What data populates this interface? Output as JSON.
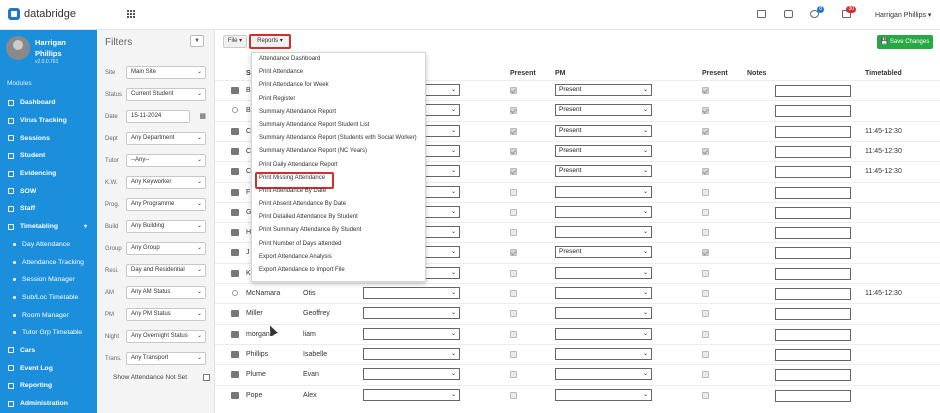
{
  "app": {
    "name": "databridge",
    "user": "Harrigan Phillips",
    "badge1": "8",
    "badge2": "30"
  },
  "profile": {
    "name_line1": "Harrigan",
    "name_line2": "Phillips",
    "version": "v2.0.0.761"
  },
  "sidebar": {
    "section": "Modules",
    "items": [
      {
        "label": "Dashboard",
        "sub": false
      },
      {
        "label": "Virus Tracking",
        "sub": false
      },
      {
        "label": "Sessions",
        "sub": false
      },
      {
        "label": "Student",
        "sub": false
      },
      {
        "label": "Evidencing",
        "sub": false
      },
      {
        "label": "SOW",
        "sub": false
      },
      {
        "label": "Staff",
        "sub": false
      },
      {
        "label": "Timetabling",
        "sub": false
      },
      {
        "label": "Day Attendance",
        "sub": true
      },
      {
        "label": "Attendance Tracking",
        "sub": true
      },
      {
        "label": "Session Manager",
        "sub": true
      },
      {
        "label": "Sub/Loc Timetable",
        "sub": true
      },
      {
        "label": "Room Manager",
        "sub": true
      },
      {
        "label": "Tutor Grp Timetable",
        "sub": true
      },
      {
        "label": "Cars",
        "sub": false
      },
      {
        "label": "Event Log",
        "sub": false
      },
      {
        "label": "Reporting",
        "sub": false
      },
      {
        "label": "Administration",
        "sub": false
      }
    ]
  },
  "filters": {
    "title": "Filters",
    "show_not_set": "Show Attendance Not Set",
    "rows": [
      {
        "label": "Site",
        "value": "Main Site"
      },
      {
        "label": "Status",
        "value": "Current Student"
      },
      {
        "label": "Date",
        "value": "15-11-2024"
      },
      {
        "label": "Dept",
        "value": "Any Department"
      },
      {
        "label": "Tutor",
        "value": "--Any--"
      },
      {
        "label": "K.W.",
        "value": "Any Keyworker"
      },
      {
        "label": "Prog.",
        "value": "Any Programme"
      },
      {
        "label": "Build",
        "value": "Any Building"
      },
      {
        "label": "Group",
        "value": "Any Group"
      },
      {
        "label": "Resi.",
        "value": "Day and Residential"
      },
      {
        "label": "AM",
        "value": "Any AM Status"
      },
      {
        "label": "PM",
        "value": "Any PM Status"
      },
      {
        "label": "Night",
        "value": "Any Overnight Status"
      },
      {
        "label": "Trans.",
        "value": "Any Transport"
      }
    ]
  },
  "toolbar": {
    "file": "File ▾",
    "reports": "Reports ▾",
    "save": "Save Changes"
  },
  "table": {
    "headers": {
      "surname": "S",
      "present1": "Present",
      "pm": "PM",
      "present2": "Present",
      "notes": "Notes",
      "timetabled": "Timetabled"
    },
    "rows": [
      {
        "surname": "B",
        "first": "",
        "am": "",
        "present1": true,
        "pm": "Present",
        "present2": true,
        "timetabled": "",
        "icon": "photo"
      },
      {
        "surname": "B",
        "first": "",
        "am": "",
        "present1": true,
        "pm": "Present",
        "present2": true,
        "timetabled": "",
        "icon": "circle"
      },
      {
        "surname": "C",
        "first": "",
        "am": "",
        "present1": true,
        "pm": "Present",
        "present2": true,
        "timetabled": "11:45-12:30",
        "icon": "photo"
      },
      {
        "surname": "C",
        "first": "",
        "am": "",
        "present1": true,
        "pm": "Present",
        "present2": true,
        "timetabled": "11:45-12:30",
        "icon": "photo"
      },
      {
        "surname": "C",
        "first": "",
        "am": "",
        "present1": true,
        "pm": "Present",
        "present2": true,
        "timetabled": "11:45-12:30",
        "icon": "photo"
      },
      {
        "surname": "F",
        "first": "",
        "am": "",
        "present1": false,
        "pm": "",
        "present2": false,
        "timetabled": "",
        "icon": "photo"
      },
      {
        "surname": "G",
        "first": "",
        "am": "",
        "present1": false,
        "pm": "",
        "present2": false,
        "timetabled": "",
        "icon": "photo"
      },
      {
        "surname": "H",
        "first": "",
        "am": "",
        "present1": false,
        "pm": "",
        "present2": false,
        "timetabled": "",
        "icon": "photo"
      },
      {
        "surname": "J",
        "first": "",
        "am": "",
        "present1": true,
        "pm": "Present",
        "present2": true,
        "timetabled": "",
        "icon": "photo"
      },
      {
        "surname": "K",
        "first": "",
        "am": "",
        "present1": false,
        "pm": "",
        "present2": false,
        "timetabled": "",
        "icon": "photo"
      },
      {
        "surname": "McNamara",
        "first": "Otis",
        "am": "",
        "present1": false,
        "pm": "",
        "present2": false,
        "timetabled": "11:45-12:30",
        "icon": "circle"
      },
      {
        "surname": "Miller",
        "first": "Geoffrey",
        "am": "",
        "present1": false,
        "pm": "",
        "present2": false,
        "timetabled": "",
        "icon": "photo"
      },
      {
        "surname": "morgana",
        "first": "liam",
        "am": "",
        "present1": false,
        "pm": "",
        "present2": false,
        "timetabled": "",
        "icon": "photo"
      },
      {
        "surname": "Phillips",
        "first": "Isabelle",
        "am": "",
        "present1": false,
        "pm": "",
        "present2": false,
        "timetabled": "",
        "icon": "photo"
      },
      {
        "surname": "Plume",
        "first": "Evan",
        "am": "",
        "present1": false,
        "pm": "",
        "present2": false,
        "timetabled": "",
        "icon": "photo"
      },
      {
        "surname": "Pope",
        "first": "Alex",
        "am": "",
        "present1": false,
        "pm": "",
        "present2": false,
        "timetabled": "",
        "icon": "photo"
      }
    ]
  },
  "reports_menu": [
    "Attendance Dashboard",
    "Print Attendance",
    "Print Attendance for Week",
    "Print Register",
    "Summary Attendance Report",
    "Summary Attendance Report Student List",
    "Summary Attendance Report (Students with Social Worker)",
    "Summary Attendance Report (NC Years)",
    "Print Daily Attendance Report",
    "Print Missing Attendance",
    "Print Attendance By Date",
    "Print Absent Attendance By Date",
    "Print Detailed Attendance By Student",
    "Print Summary Attendance By Student",
    "Print Number of Days attended",
    "Export Attendance Analysis",
    "Export Attendance to Import File"
  ],
  "highlighted_menu_item": "Print Missing Attendance",
  "colors": {
    "sidebar": "#1b8fdc",
    "save": "#27a844",
    "highlight": "#d32f2f"
  }
}
